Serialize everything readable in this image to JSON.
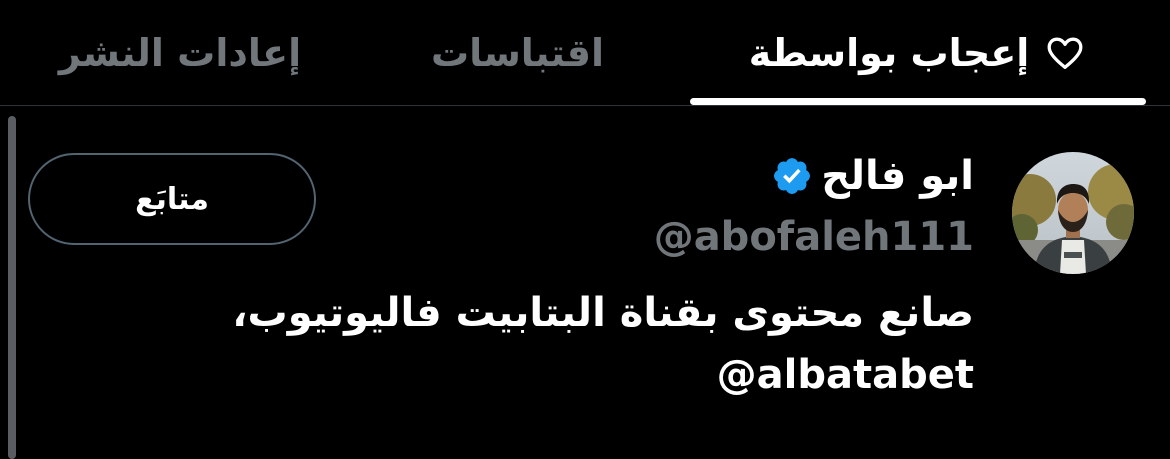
{
  "tabs": [
    {
      "id": "likes",
      "label": "إعجاب بواسطة",
      "icon": "heart-outline-icon",
      "active": true
    },
    {
      "id": "quotes",
      "label": "اقتباسات",
      "active": false
    },
    {
      "id": "reposts",
      "label": "إعادات النشر",
      "active": false
    }
  ],
  "user": {
    "display_name": "ابو فالح",
    "verified": true,
    "verified_icon": "verified-badge-icon",
    "handle": "@abofaleh111",
    "bio": {
      "line1": "صانع محتوى بقناة البتابيت فاليوتيوب،",
      "line2": "@albatabet"
    },
    "follow_button_label": "متابَع"
  },
  "colors": {
    "background": "#000000",
    "text_primary": "#ffffff",
    "text_secondary": "#71767b",
    "verified_blue": "#1d9bf0",
    "divider": "#2f3336",
    "button_border": "#536471"
  }
}
